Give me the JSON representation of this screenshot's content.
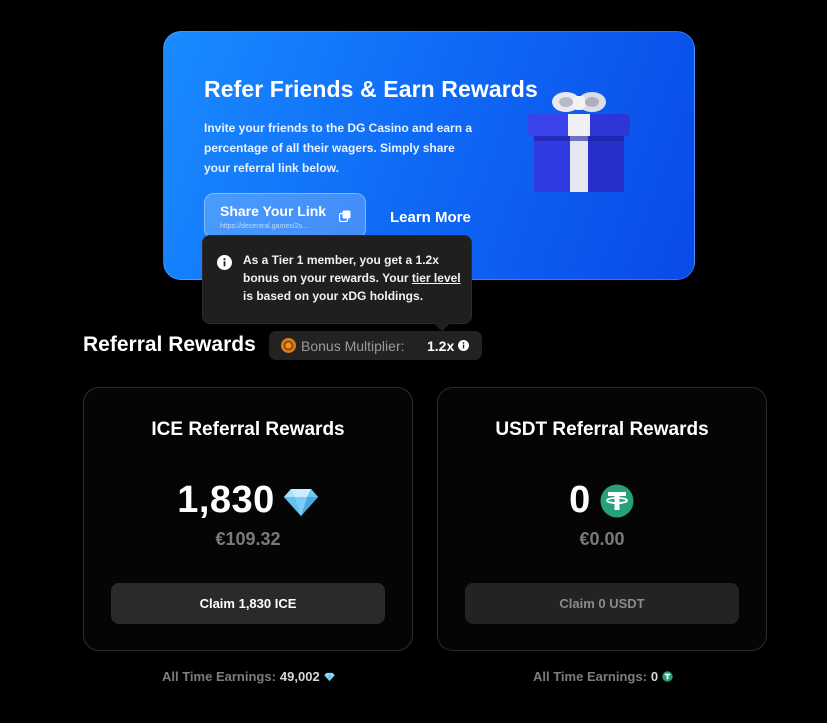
{
  "banner": {
    "title": "Refer Friends & Earn Rewards",
    "description": "Invite your friends to the DG Casino and earn a percentage of all their wagers. Simply share your referral link below.",
    "share_label": "Share Your Link",
    "share_url": "https://decentral.games/2s...",
    "learn_more": "Learn More"
  },
  "tooltip": {
    "text_before": "As a Tier 1 member, you get a 1.2x bonus on your rewards. Your ",
    "link_text": "tier level",
    "text_after": " is based on your xDG holdings."
  },
  "section": {
    "title": "Referral Rewards",
    "multiplier_label": "Bonus Multiplier:",
    "multiplier_value": "1.2x"
  },
  "cards": {
    "ice": {
      "title": "ICE Referral Rewards",
      "amount": "1,830",
      "fiat": "€109.32",
      "claim_label": "Claim 1,830 ICE",
      "earnings_label": "All Time Earnings:",
      "earnings_value": "49,002"
    },
    "usdt": {
      "title": "USDT Referral Rewards",
      "amount": "0",
      "fiat": "€0.00",
      "claim_label": "Claim 0 USDT",
      "earnings_label": "All Time Earnings:",
      "earnings_value": "0"
    }
  },
  "icons": {
    "copy": "copy-icon",
    "gift": "gift-icon",
    "info": "info-icon",
    "coin": "coin-icon",
    "ice": "ice-diamond-icon",
    "usdt": "tether-icon"
  },
  "colors": {
    "banner_start": "#1a8bff",
    "banner_end": "#0a49e8",
    "tether_green": "#26a17b",
    "ice_blue": "#7fd3ff"
  }
}
